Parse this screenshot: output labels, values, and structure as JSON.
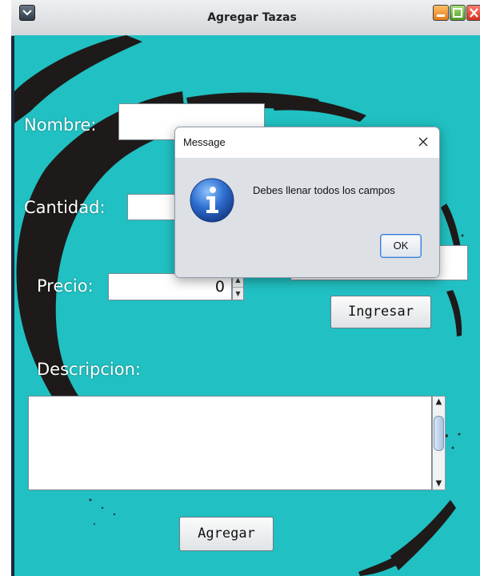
{
  "window": {
    "title": "Agregar Tazas"
  },
  "form": {
    "nombre_label": "Nombre:",
    "nombre_value": "",
    "cantidad_label": "Cantidad:",
    "cantidad_value": "",
    "precio_label": "Precio:",
    "precio_value": "0",
    "ingresar_label": "Ingresar",
    "descripcion_label": "Descripcion:",
    "descripcion_value": "",
    "agregar_label": "Agregar"
  },
  "dialog": {
    "title": "Message",
    "message": "Debes llenar todos los campos",
    "ok_label": "OK",
    "icon": "info-icon"
  },
  "colors": {
    "background": "#21c0c2",
    "brush": "#1e1a19",
    "dialog_body": "#dde0e5"
  }
}
